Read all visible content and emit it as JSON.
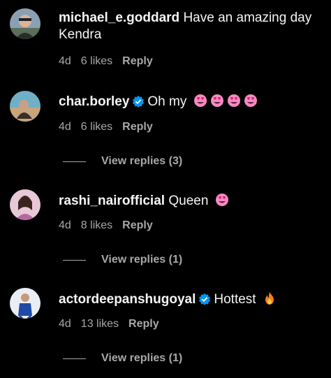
{
  "comments": [
    {
      "username": "michael_e.goddard",
      "text": "Have an amazing day Kendra",
      "time": "4d",
      "likes": "6 likes",
      "reply": "Reply"
    },
    {
      "username": "char.borley",
      "verified": true,
      "text": "Oh my",
      "emoji": "heart-eyes x4",
      "time": "4d",
      "likes": "6 likes",
      "reply": "Reply",
      "view_replies": "View replies (3)"
    },
    {
      "username": "rashi_nairofficial",
      "text": "Queen",
      "emoji": "heart-eyes",
      "time": "4d",
      "likes": "8 likes",
      "reply": "Reply",
      "view_replies": "View replies (1)"
    },
    {
      "username": "actordeepanshugoyal",
      "verified": true,
      "text": "Hottest",
      "emoji": "fire",
      "time": "4d",
      "likes": "13 likes",
      "reply": "Reply",
      "view_replies": "View replies (1)"
    }
  ],
  "colors": {
    "background": "#000000",
    "text": "#f5f5f5",
    "muted": "#a8a8a8",
    "verified": "#0095f6"
  }
}
